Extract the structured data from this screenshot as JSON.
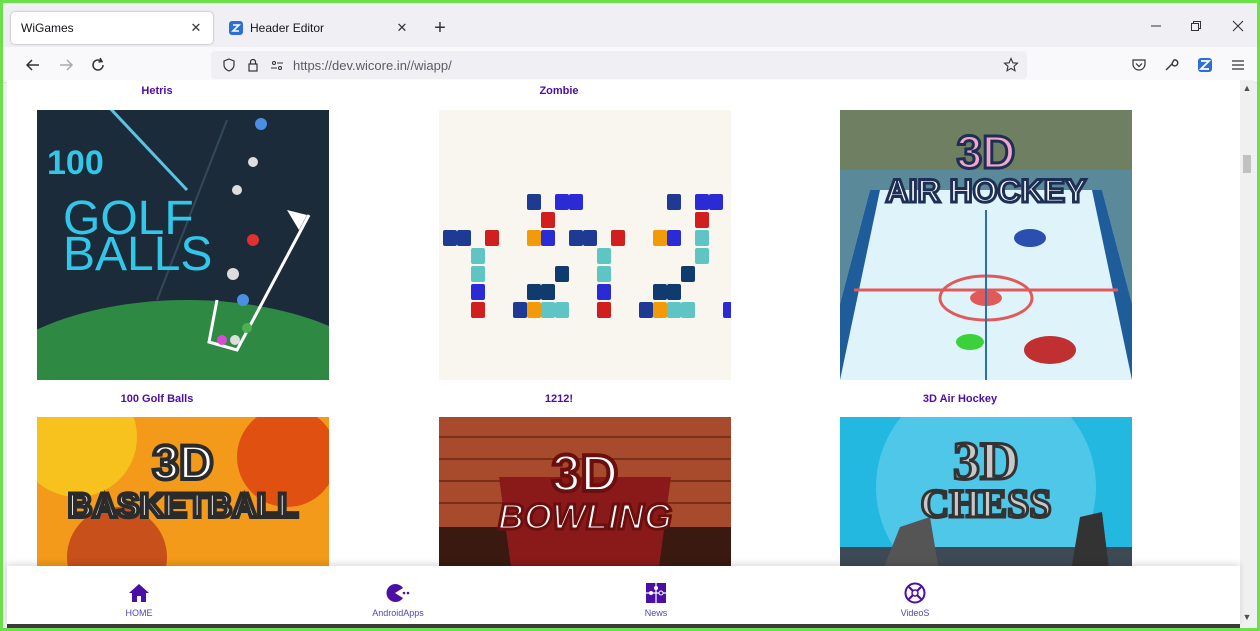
{
  "browser": {
    "tabs": [
      {
        "title": "WiGames",
        "active": true
      },
      {
        "title": "Header Editor",
        "active": false
      }
    ],
    "url": "https://dev.wicore.in//wiapp/"
  },
  "top_labels": [
    "Hetris",
    "Zombie"
  ],
  "games": [
    {
      "name": "100 Golf Balls",
      "art_lines": [
        "100",
        "GOLF",
        "BALLS"
      ]
    },
    {
      "name": "1212!",
      "art_lines": []
    },
    {
      "name": "3D Air Hockey",
      "art_lines": [
        "3D",
        "AIR HOCKEY"
      ]
    },
    {
      "name": "",
      "art_lines": [
        "3D",
        "BASKETBALL"
      ]
    },
    {
      "name": "",
      "art_lines": [
        "3D",
        "BOWLING"
      ]
    },
    {
      "name": "",
      "art_lines": [
        "3D",
        "CHESS"
      ]
    }
  ],
  "bottom_nav": [
    {
      "label": "HOME",
      "icon": "home-icon"
    },
    {
      "label": "AndroidApps",
      "icon": "pacman-icon"
    },
    {
      "label": "News",
      "icon": "puzzle-icon"
    },
    {
      "label": "VideoS",
      "icon": "crossed-circle-icon"
    }
  ],
  "colors": {
    "frame": "#6be04a",
    "label": "#4b0fa5",
    "nav_accent": "#4b0fa5"
  }
}
